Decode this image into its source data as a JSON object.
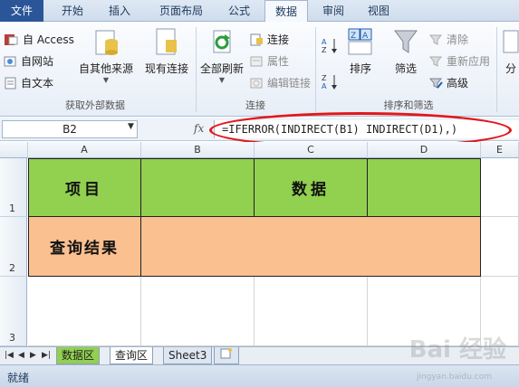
{
  "ribbon": {
    "tabs": [
      "文件",
      "开始",
      "插入",
      "页面布局",
      "公式",
      "数据",
      "审阅",
      "视图"
    ],
    "active_tab": "数据",
    "get_external": {
      "access": "自 Access",
      "web": "自网站",
      "text": "自文本",
      "other": "自其他来源",
      "existing": "现有连接",
      "label": "获取外部数据"
    },
    "connections": {
      "refresh_all": "全部刷新",
      "connections": "连接",
      "properties": "属性",
      "edit_links": "编辑链接",
      "label": "连接"
    },
    "sort_filter": {
      "sort": "排序",
      "filter": "筛选",
      "clear": "清除",
      "reapply": "重新应用",
      "advanced": "高级",
      "label": "排序和筛选"
    },
    "overflow": "分"
  },
  "formula_bar": {
    "name_box": "B2",
    "fx": "fx",
    "formula": "=IFERROR(INDIRECT(B1) INDIRECT(D1),)"
  },
  "grid": {
    "columns": [
      "A",
      "B",
      "C",
      "D",
      "E"
    ],
    "rows": [
      "1",
      "2",
      "3"
    ],
    "cells": {
      "A1": "项目",
      "C1": "数据",
      "A2": "查询结果"
    }
  },
  "sheets": {
    "tabs": [
      "数据区",
      "查询区",
      "Sheet3"
    ],
    "active": "查询区"
  },
  "status": {
    "mode": "就绪"
  },
  "watermark": {
    "logo": "Bai 经验",
    "url": "jingyan.baidu.com"
  },
  "colors": {
    "green_fill": "#92d050",
    "orange_fill": "#fac090",
    "annotation_red": "#e2171c",
    "file_tab": "#2a5699"
  }
}
